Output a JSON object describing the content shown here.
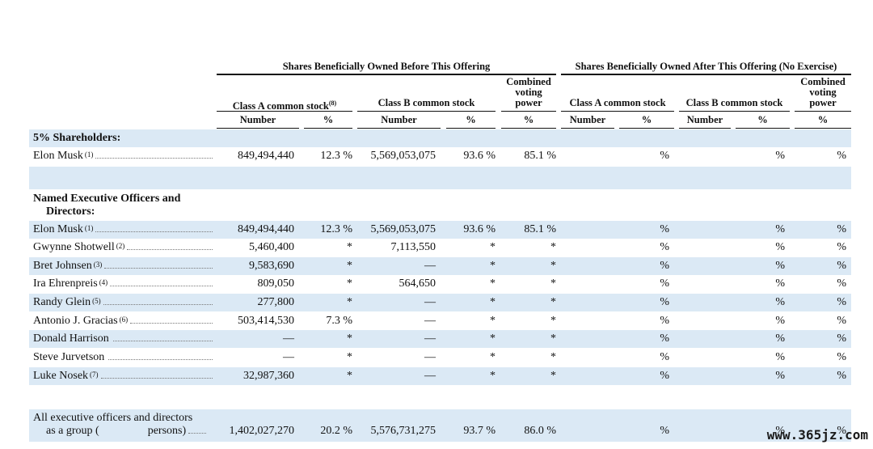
{
  "headers": {
    "before": "Shares Beneficially Owned Before This Offering",
    "after": "Shares Beneficially Owned After This Offering (No Exercise)",
    "class_a": "Class A common stock",
    "class_a_note": "(8)",
    "class_b": "Class B common stock",
    "combined_1": "Combined",
    "combined_2": "voting",
    "combined_3": "power",
    "number": "Number",
    "pct": "%"
  },
  "sections": {
    "five_pct": "5% Shareholders:",
    "named_1": "Named Executive Officers and",
    "named_2": "Directors:"
  },
  "rows": [
    {
      "name": "Elon Musk",
      "note": "(1)",
      "a_num": "849,494,440",
      "a_pct": "12.3 %",
      "b_num": "5,569,053,075",
      "b_pct": "93.6 %",
      "vote": "85.1 %",
      "after_a_pct": "%",
      "after_b_pct": "%",
      "after_vote": "%"
    },
    {
      "name": "Elon Musk",
      "note": "(1)",
      "a_num": "849,494,440",
      "a_pct": "12.3 %",
      "b_num": "5,569,053,075",
      "b_pct": "93.6 %",
      "vote": "85.1 %",
      "after_a_pct": "%",
      "after_b_pct": "%",
      "after_vote": "%"
    },
    {
      "name": "Gwynne Shotwell",
      "note": "(2)",
      "a_num": "5,460,400",
      "a_pct": "*",
      "b_num": "7,113,550",
      "b_pct": "*",
      "vote": "*",
      "after_a_pct": "%",
      "after_b_pct": "%",
      "after_vote": "%"
    },
    {
      "name": "Bret Johnsen",
      "note": "(3)",
      "a_num": "9,583,690",
      "a_pct": "*",
      "b_num": "—",
      "b_pct": "*",
      "vote": "*",
      "after_a_pct": "%",
      "after_b_pct": "%",
      "after_vote": "%"
    },
    {
      "name": "Ira Ehrenpreis",
      "note": "(4)",
      "a_num": "809,050",
      "a_pct": "*",
      "b_num": "564,650",
      "b_pct": "*",
      "vote": "*",
      "after_a_pct": "%",
      "after_b_pct": "%",
      "after_vote": "%"
    },
    {
      "name": "Randy Glein",
      "note": "(5)",
      "a_num": "277,800",
      "a_pct": "*",
      "b_num": "—",
      "b_pct": "*",
      "vote": "*",
      "after_a_pct": "%",
      "after_b_pct": "%",
      "after_vote": "%"
    },
    {
      "name": "Antonio J. Gracias",
      "note": "(6)",
      "a_num": "503,414,530",
      "a_pct": "7.3 %",
      "b_num": "—",
      "b_pct": "*",
      "vote": "*",
      "after_a_pct": "%",
      "after_b_pct": "%",
      "after_vote": "%"
    },
    {
      "name": "Donald Harrison",
      "note": "",
      "a_num": "—",
      "a_pct": "*",
      "b_num": "—",
      "b_pct": "*",
      "vote": "*",
      "after_a_pct": "%",
      "after_b_pct": "%",
      "after_vote": "%"
    },
    {
      "name": "Steve Jurvetson",
      "note": "",
      "a_num": "—",
      "a_pct": "*",
      "b_num": "—",
      "b_pct": "*",
      "vote": "*",
      "after_a_pct": "%",
      "after_b_pct": "%",
      "after_vote": "%"
    },
    {
      "name": "Luke Nosek",
      "note": "(7)",
      "a_num": "32,987,360",
      "a_pct": "*",
      "b_num": "—",
      "b_pct": "*",
      "vote": "*",
      "after_a_pct": "%",
      "after_b_pct": "%",
      "after_vote": "%"
    }
  ],
  "group_row": {
    "name_1": "All executive officers and directors",
    "name_2": "as a group (",
    "name_3": "persons)",
    "a_num": "1,402,027,270",
    "a_pct": "20.2 %",
    "b_num": "5,576,731,275",
    "b_pct": "93.7 %",
    "vote": "86.0 %",
    "after_a_pct": "%",
    "after_b_pct": "%",
    "after_vote": "%"
  },
  "watermark": "www.365jz.com",
  "colors": {
    "band": "#dbe9f5",
    "text": "#111111"
  }
}
